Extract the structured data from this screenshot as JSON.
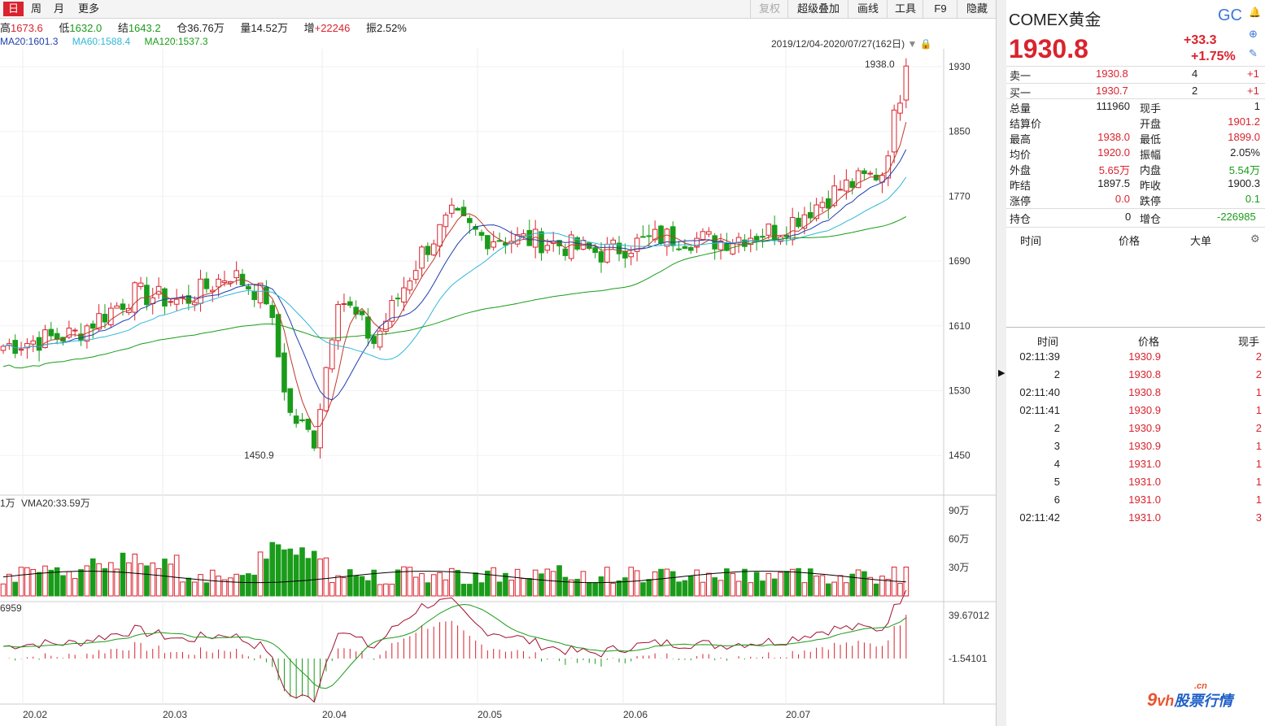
{
  "toolbar": {
    "tabs": [
      "日",
      "周",
      "月",
      "更多"
    ],
    "buttons": [
      "复权",
      "超级叠加",
      "画线",
      "工具",
      "F9",
      "隐藏"
    ]
  },
  "info": {
    "high_label": "高",
    "high": "1673.6",
    "low_label": "低",
    "low": "1632.0",
    "settle_label": "结",
    "settle": "1643.2",
    "oi_label": "仓",
    "oi": "36.76万",
    "vol_label": "量",
    "vol": "14.52万",
    "inc_label": "增",
    "inc": "+22246",
    "amp_label": "振",
    "amp": "2.52%"
  },
  "ma": {
    "ma20": "MA20:1601.3",
    "ma60": "MA60:1588.4",
    "ma120": "MA120:1537.3"
  },
  "date_range": "2019/12/04-2020/07/27(162日)",
  "price_axis": [
    "1930",
    "1850",
    "1770",
    "1690",
    "1610",
    "1530",
    "1450"
  ],
  "max_label": "1938.0",
  "min_label": "1450.9",
  "vol_axis": [
    "90万",
    "60万",
    "30万"
  ],
  "vol_title_prefix": "1万",
  "vol_ma": "VMA20:33.59万",
  "macd_axis": [
    "39.67012",
    "-1.54101"
  ],
  "macd_prefix": "6959",
  "date_axis": [
    "20.02",
    "20.03",
    "20.04",
    "20.05",
    "20.06",
    "20.07"
  ],
  "colors": {
    "up": "#d9232e",
    "down": "#1a9c1a",
    "ma5": "#c0392b",
    "ma10": "#1f3fae",
    "ma20": "#2fb7d8",
    "ma60": "#1a9c1a"
  },
  "panel": {
    "name": "COMEX黄金",
    "code": "GC",
    "price": "1930.8",
    "change": "+33.3",
    "change_pct": "+1.75%",
    "ask_label": "卖一",
    "ask": "1930.8",
    "ask_vol": "4",
    "ask_chg": "+1",
    "bid_label": "买一",
    "bid": "1930.7",
    "bid_vol": "2",
    "bid_chg": "+1",
    "stats": [
      {
        "l1": "总量",
        "v1": "111960",
        "l2": "现手",
        "v2": "1",
        "c1": "#222",
        "c2": "#222"
      },
      {
        "l1": "结算价",
        "v1": "",
        "l2": "开盘",
        "v2": "1901.2",
        "c1": "#222",
        "c2": "#d9232e"
      },
      {
        "l1": "最高",
        "v1": "1938.0",
        "l2": "最低",
        "v2": "1899.0",
        "c1": "#d9232e",
        "c2": "#d9232e"
      },
      {
        "l1": "均价",
        "v1": "1920.0",
        "l2": "振幅",
        "v2": "2.05%",
        "c1": "#d9232e",
        "c2": "#222"
      },
      {
        "l1": "外盘",
        "v1": "5.65万",
        "l2": "内盘",
        "v2": "5.54万",
        "c1": "#d9232e",
        "c2": "#1a9c1a"
      },
      {
        "l1": "昨结",
        "v1": "1897.5",
        "l2": "昨收",
        "v2": "1900.3",
        "c1": "#222",
        "c2": "#222"
      },
      {
        "l1": "涨停",
        "v1": "0.0",
        "l2": "跌停",
        "v2": "0.1",
        "c1": "#d9232e",
        "c2": "#1a9c1a"
      }
    ],
    "oi_label": "持仓",
    "oi": "0",
    "oi_inc_label": "增仓",
    "oi_inc": "-226985",
    "big_head": [
      "时间",
      "价格",
      "大单"
    ],
    "tick_head": [
      "时间",
      "价格",
      "现手"
    ],
    "ticks": [
      {
        "t": "02:11:39",
        "p": "1930.9",
        "v": "2"
      },
      {
        "t": "2",
        "p": "1930.8",
        "v": "2"
      },
      {
        "t": "02:11:40",
        "p": "1930.8",
        "v": "1"
      },
      {
        "t": "02:11:41",
        "p": "1930.9",
        "v": "1"
      },
      {
        "t": "2",
        "p": "1930.9",
        "v": "2"
      },
      {
        "t": "3",
        "p": "1930.9",
        "v": "1"
      },
      {
        "t": "4",
        "p": "1931.0",
        "v": "1"
      },
      {
        "t": "5",
        "p": "1931.0",
        "v": "1"
      },
      {
        "t": "6",
        "p": "1931.0",
        "v": "1"
      },
      {
        "t": "02:11:42",
        "p": "1931.0",
        "v": "3"
      }
    ]
  },
  "logo": {
    "text": "9vh股票行情",
    "sub": ".cn"
  }
}
